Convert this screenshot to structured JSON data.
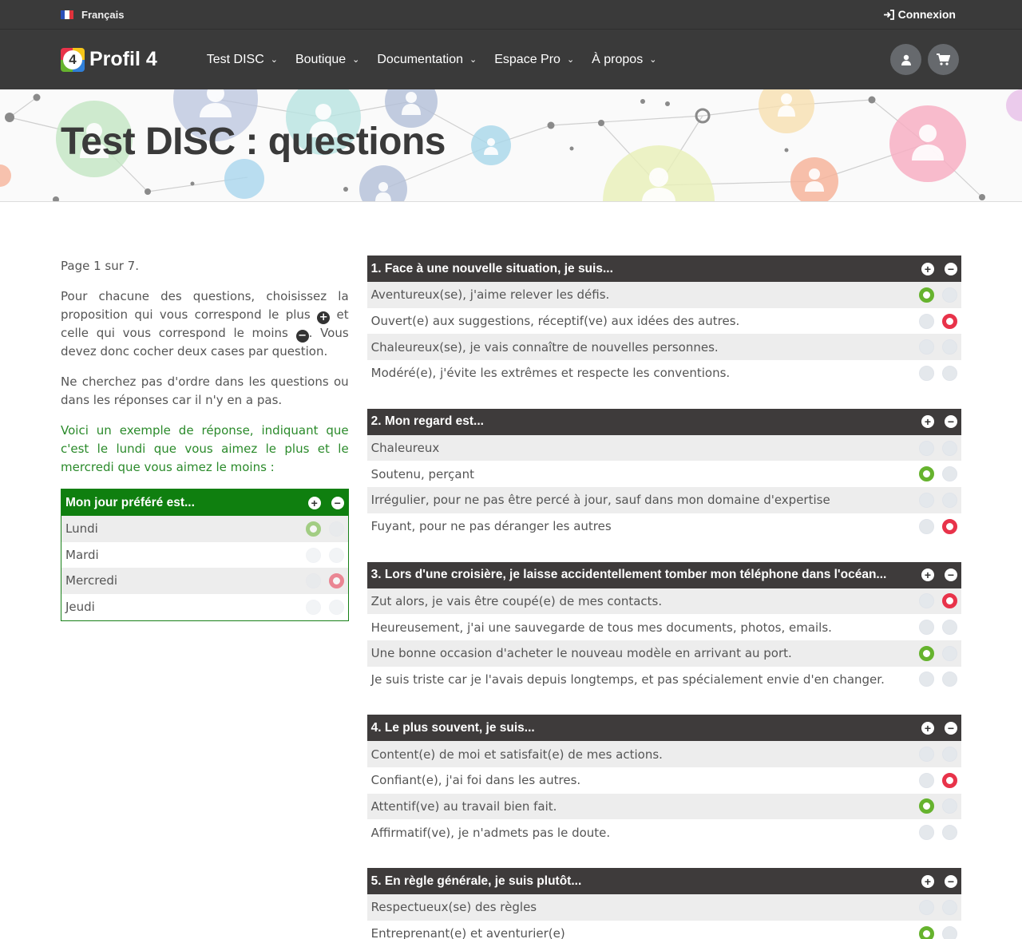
{
  "topbar": {
    "language": "Français",
    "login": "Connexion"
  },
  "nav": {
    "brand": "Profil 4",
    "logo_digit": "4",
    "items": [
      {
        "label": "Test DISC"
      },
      {
        "label": "Boutique"
      },
      {
        "label": "Documentation"
      },
      {
        "label": "Espace Pro"
      },
      {
        "label": "À propos"
      }
    ]
  },
  "hero": {
    "title": "Test DISC : questions"
  },
  "intro": {
    "page": "Page 1 sur 7.",
    "instr_part1": "Pour chacune des questions, choisissez la proposition qui vous correspond le plus",
    "instr_part2": "et celle qui vous correspond le moins",
    "instr_part3": ". Vous devez donc cocher deux cases par question.",
    "no_order": "Ne cherchez pas d'ordre dans les questions ou dans les réponses car il n'y en a pas.",
    "example_note": "Voici un exemple de réponse, indiquant que c'est le lundi que vous aimez le plus et le mercredi que vous aimez le moins :"
  },
  "example": {
    "title": "Mon jour préféré est...",
    "answers": [
      {
        "label": "Lundi",
        "state": "plus"
      },
      {
        "label": "Mardi",
        "state": "none"
      },
      {
        "label": "Mercredi",
        "state": "minus"
      },
      {
        "label": "Jeudi",
        "state": "none"
      }
    ]
  },
  "questions": [
    {
      "title": "1. Face à une nouvelle situation, je suis...",
      "answers": [
        {
          "label": "Aventureux(se), j'aime relever les défis.",
          "state": "plus"
        },
        {
          "label": "Ouvert(e) aux suggestions, réceptif(ve) aux idées des autres.",
          "state": "minus"
        },
        {
          "label": "Chaleureux(se), je vais connaître de nouvelles personnes.",
          "state": "none"
        },
        {
          "label": "Modéré(e), j'évite les extrêmes et respecte les conventions.",
          "state": "none"
        }
      ]
    },
    {
      "title": "2. Mon regard est...",
      "answers": [
        {
          "label": "Chaleureux",
          "state": "none"
        },
        {
          "label": "Soutenu, perçant",
          "state": "plus"
        },
        {
          "label": "Irrégulier, pour ne pas être percé à jour, sauf dans mon domaine d'expertise",
          "state": "none"
        },
        {
          "label": "Fuyant, pour ne pas déranger les autres",
          "state": "minus"
        }
      ]
    },
    {
      "title": "3. Lors d'une croisière, je laisse accidentellement tomber mon téléphone dans l'océan...",
      "answers": [
        {
          "label": "Zut alors, je vais être coupé(e) de mes contacts.",
          "state": "minus"
        },
        {
          "label": "Heureusement, j'ai une sauvegarde de tous mes documents, photos, emails.",
          "state": "none"
        },
        {
          "label": "Une bonne occasion d'acheter le nouveau modèle en arrivant au port.",
          "state": "plus"
        },
        {
          "label": "Je suis triste car je l'avais depuis longtemps, et pas spécialement envie d'en changer.",
          "state": "none"
        }
      ]
    },
    {
      "title": "4. Le plus souvent, je suis...",
      "answers": [
        {
          "label": "Content(e) de moi et satisfait(e) de mes actions.",
          "state": "none"
        },
        {
          "label": "Confiant(e), j'ai foi dans les autres.",
          "state": "minus"
        },
        {
          "label": "Attentif(ve) au travail bien fait.",
          "state": "plus"
        },
        {
          "label": "Affirmatif(ve), je n'admets pas le doute.",
          "state": "none"
        }
      ]
    },
    {
      "title": "5. En règle générale, je suis plutôt...",
      "answers": [
        {
          "label": "Respectueux(se) des règles",
          "state": "none"
        },
        {
          "label": "Entreprenant(e) et aventurier(e)",
          "state": "plus"
        }
      ]
    }
  ],
  "colors": {
    "dark_bar": "#3a3a3a",
    "question_header": "#3e3b3b",
    "plus": "#66b32e",
    "minus": "#e8334a",
    "example_header": "#0f7f0f"
  },
  "icons": [
    "flag-fr-icon",
    "sign-in-icon",
    "chevron-down-icon",
    "user-icon",
    "cart-icon",
    "plus-icon",
    "minus-icon"
  ]
}
